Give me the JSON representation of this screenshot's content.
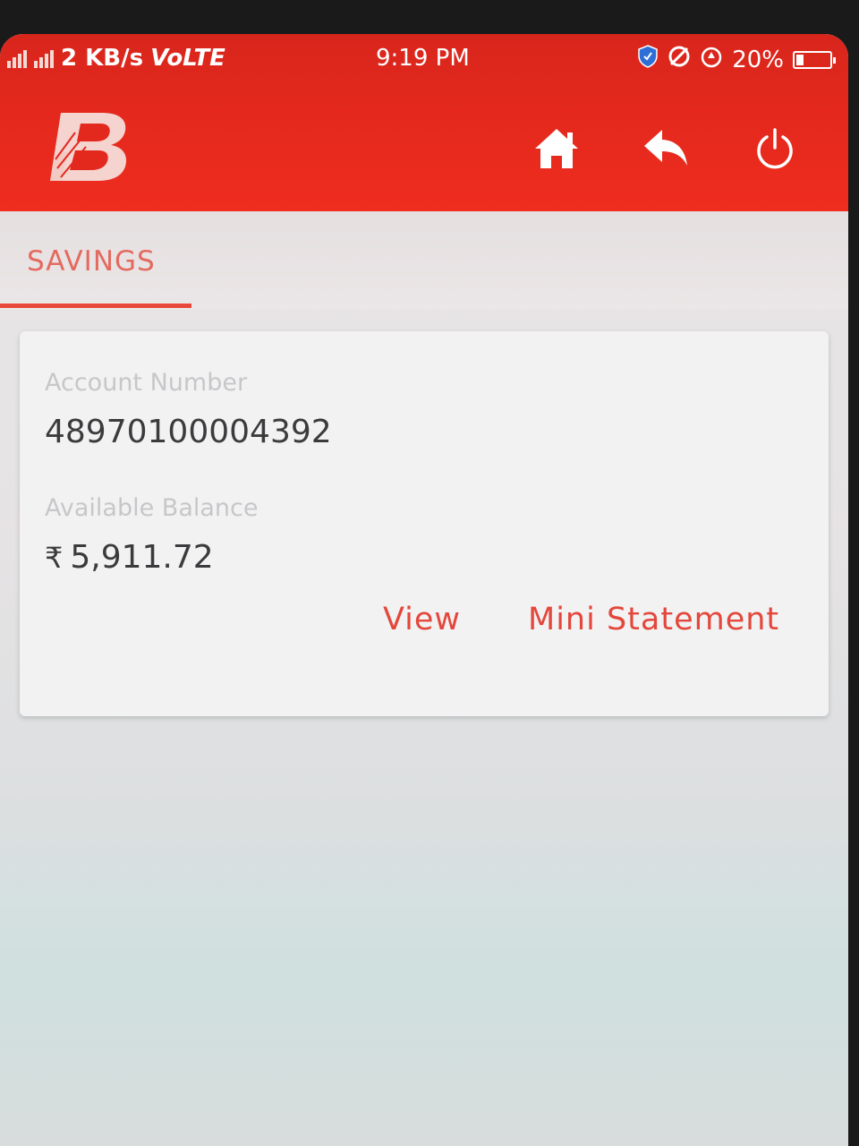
{
  "status_bar": {
    "network_speed": "2 KB/s",
    "network_type": "VoLTE",
    "time": "9:19 PM",
    "battery_percent": "20%",
    "battery_level": 0.2,
    "icons": [
      "signal-icon",
      "shield-icon",
      "do-not-disturb-icon",
      "alarm-icon",
      "battery-icon"
    ]
  },
  "header": {
    "logo_icon": "bank-logo-icon",
    "actions": [
      "home-icon",
      "back-icon",
      "power-icon"
    ]
  },
  "tabs": [
    {
      "label": "SAVINGS",
      "active": true
    }
  ],
  "account": {
    "number_label": "Account Number",
    "number": "48970100004392",
    "balance_label": "Available Balance",
    "currency_symbol": "₹",
    "balance": "5,911.72",
    "view_label": "View",
    "mini_statement_label": "Mini Statement"
  },
  "colors": {
    "header": "#e3281d",
    "accent": "#e4473b",
    "card": "#f2f2f3"
  }
}
